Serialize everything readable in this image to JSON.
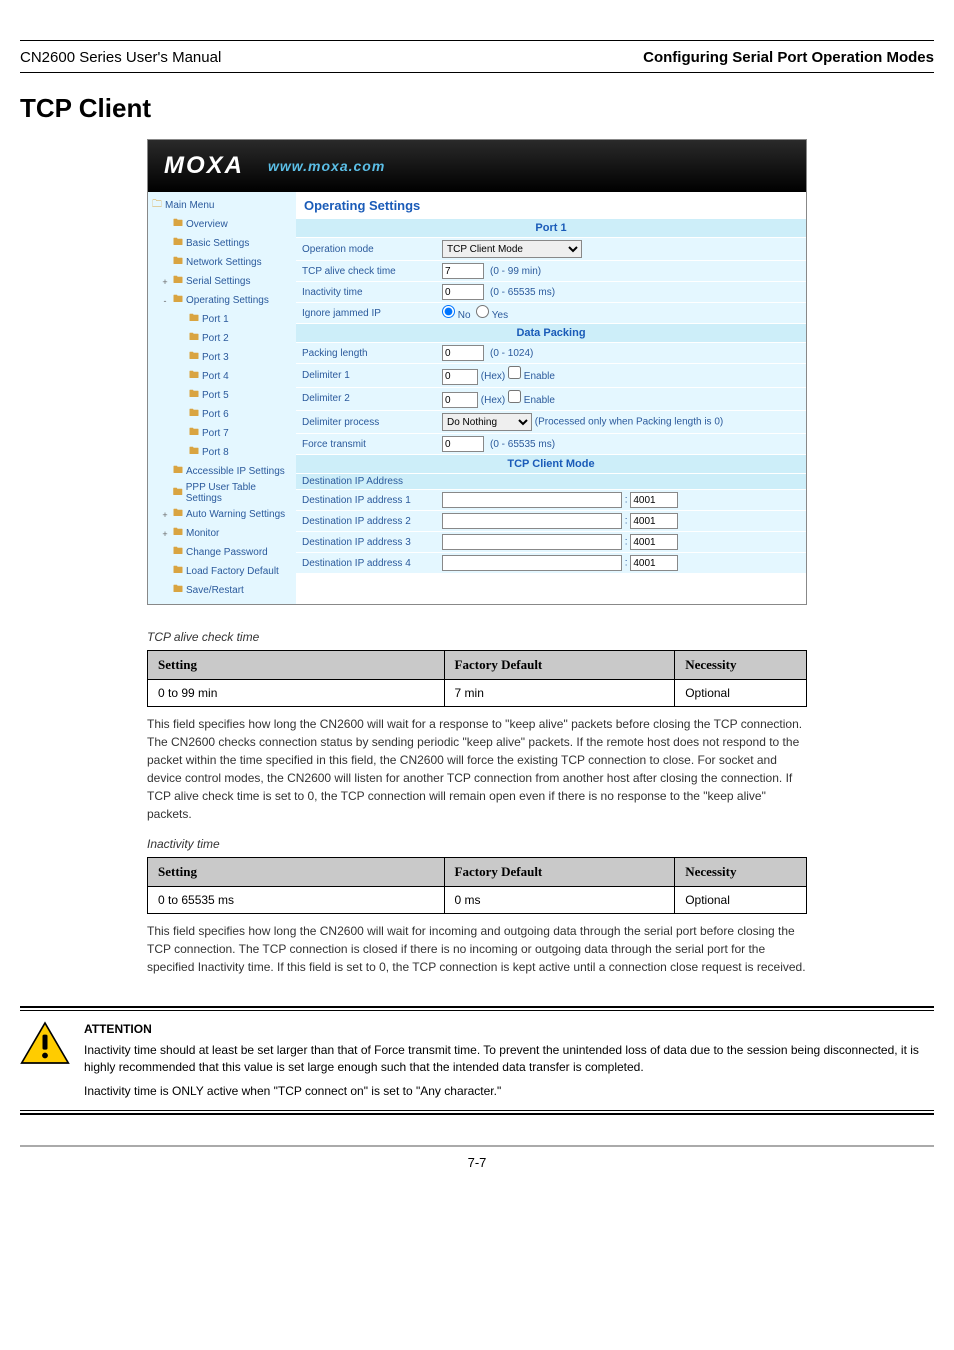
{
  "header": {
    "product": "CN2600 Series User's Manual",
    "section": "Configuring Serial Port Operation Modes"
  },
  "section_title": "TCP Client",
  "moxa": {
    "logo": "MOXA",
    "url": "www.moxa.com"
  },
  "sidebar": {
    "root": "Main Menu",
    "items": [
      {
        "label": "Overview",
        "lvl": 1
      },
      {
        "label": "Basic Settings",
        "lvl": 1
      },
      {
        "label": "Network Settings",
        "lvl": 1
      },
      {
        "label": "Serial Settings",
        "lvl": 1,
        "expand": "+"
      },
      {
        "label": "Operating Settings",
        "lvl": 1,
        "expand": "-"
      },
      {
        "label": "Port 1",
        "lvl": 2
      },
      {
        "label": "Port 2",
        "lvl": 2
      },
      {
        "label": "Port 3",
        "lvl": 2
      },
      {
        "label": "Port 4",
        "lvl": 2
      },
      {
        "label": "Port 5",
        "lvl": 2
      },
      {
        "label": "Port 6",
        "lvl": 2
      },
      {
        "label": "Port 7",
        "lvl": 2
      },
      {
        "label": "Port 8",
        "lvl": 2
      },
      {
        "label": "Accessible IP Settings",
        "lvl": 1
      },
      {
        "label": "PPP User Table Settings",
        "lvl": 1
      },
      {
        "label": "Auto Warning Settings",
        "lvl": 1,
        "expand": "+"
      },
      {
        "label": "Monitor",
        "lvl": 1,
        "expand": "+"
      },
      {
        "label": "Change Password",
        "lvl": 1
      },
      {
        "label": "Load Factory Default",
        "lvl": 1
      },
      {
        "label": "Save/Restart",
        "lvl": 1
      }
    ]
  },
  "main": {
    "title": "Operating Settings",
    "port_header": "Port 1",
    "rows": {
      "op_mode_label": "Operation mode",
      "op_mode_value": "TCP Client Mode",
      "alive_label": "TCP alive check time",
      "alive_value": "7",
      "alive_range": "(0 - 99 min)",
      "inact_label": "Inactivity time",
      "inact_value": "0",
      "inact_range": "(0 - 65535 ms)",
      "jammed_label": "Ignore jammed IP",
      "jammed_no": "No",
      "jammed_yes": "Yes"
    },
    "packing_header": "Data Packing",
    "packing": {
      "len_label": "Packing length",
      "len_value": "0",
      "len_range": "(0 - 1024)",
      "d1_label": "Delimiter 1",
      "d1_value": "0",
      "d1_hint": "(Hex)",
      "enable": "Enable",
      "d2_label": "Delimiter 2",
      "d2_value": "0",
      "d2_hint": "(Hex)",
      "dp_label": "Delimiter process",
      "dp_value": "Do Nothing",
      "dp_hint": "(Processed only when Packing length is 0)",
      "ft_label": "Force transmit",
      "ft_value": "0",
      "ft_range": "(0 - 65535 ms)"
    },
    "client_header": "TCP Client Mode",
    "dest_header": "Destination IP Address",
    "dest": [
      {
        "label": "Destination IP address 1",
        "port": "4001"
      },
      {
        "label": "Destination IP address 2",
        "port": "4001"
      },
      {
        "label": "Destination IP address 3",
        "port": "4001"
      },
      {
        "label": "Destination IP address 4",
        "port": "4001"
      }
    ]
  },
  "table1": {
    "h1": "Setting",
    "h2": "Factory Default",
    "h3": "Necessity",
    "r1c1": "0 to 99 min",
    "r1c2": "7 min",
    "r1c3": "Optional"
  },
  "table1_lead": "TCP alive check time",
  "para1": "This field specifies how long the CN2600 will wait for a response to \"keep alive\" packets before closing the TCP connection. The CN2600 checks connection status by sending periodic \"keep alive\" packets. If the remote host does not respond to the packet within the time specified in this field, the CN2600 will force the existing TCP connection to close. For socket and device control modes, the CN2600 will listen for another TCP connection from another host after closing the connection. If TCP alive check time is set to 0, the TCP connection will remain open even if there is no response to the \"keep alive\" packets.",
  "table2_lead": "Inactivity time",
  "table2": {
    "h1": "Setting",
    "h2": "Factory Default",
    "h3": "Necessity",
    "r1c1": "0 to 65535 ms",
    "r1c2": "0 ms",
    "r1c3": "Optional"
  },
  "para2": "This field specifies how long the CN2600 will wait for incoming and outgoing data through the serial port before closing the TCP connection. The TCP connection is closed if there is no incoming or outgoing data through the serial port for the specified Inactivity time. If this field is set to 0, the TCP connection is kept active until a connection close request is received.",
  "attention": {
    "head": "ATTENTION",
    "p1": "Inactivity time should at least be set larger than that of Force transmit time. To prevent the unintended loss of data due to the session being disconnected, it is highly recommended that this value is set large enough such that the intended data transfer is completed.",
    "p2": "Inactivity time is ONLY active when \"TCP connect on\" is set to \"Any character.\""
  },
  "page_num": "7-7"
}
